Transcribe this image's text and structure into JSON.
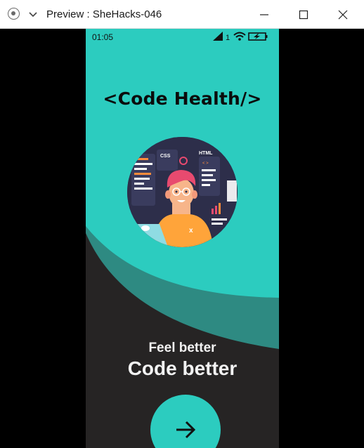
{
  "window": {
    "title": "Preview : SheHacks-046"
  },
  "status_bar": {
    "time": "01:05",
    "sim_label": "1"
  },
  "app": {
    "headline": "<Code Health/>",
    "illustration_labels": {
      "css": "CSS",
      "html": "HTML",
      "code_tag": "< >",
      "shirt_mark": "x"
    },
    "tagline": "Feel better",
    "subline": "Code better",
    "next_button_icon": "arrow-right-icon"
  },
  "colors": {
    "teal": "#2cccbf",
    "dark_teal": "#2e8a82",
    "charcoal": "#262424"
  }
}
